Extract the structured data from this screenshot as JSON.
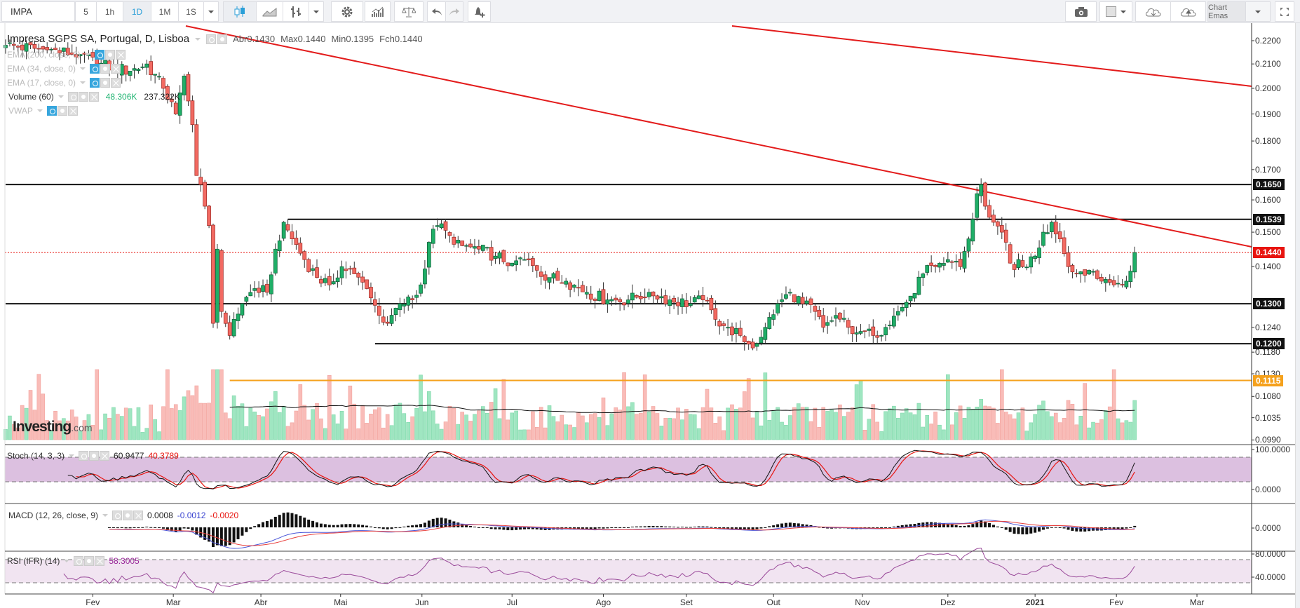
{
  "toolbar": {
    "symbol": "IMPA",
    "intervals": [
      "5",
      "1h",
      "1D",
      "1M",
      "1S"
    ],
    "active_interval": "1D",
    "chart_name": "Chart Emas"
  },
  "legend": {
    "title": "Impresa SGPS SA, Portugal, D, Lisboa",
    "open": "Abr0.1430",
    "high": "Max0.1440",
    "low": "Min0.1395",
    "close": "Fch0.1440",
    "ema200": "EMA (200, close, 0)",
    "ema34": "EMA (34, close, 0)",
    "ema17": "EMA (17, close, 0)",
    "volume": "Volume (60)",
    "volume_value": "48.306K",
    "volume_ma": "237.322K",
    "vwap": "VWAP",
    "stoch": "Stoch (14, 3, 3)",
    "stoch_k": "60.9477",
    "stoch_d": "40.3789",
    "macd": "MACD (12, 26, close, 9)",
    "macd_hist": "0.0008",
    "macd_line": "-0.0012",
    "macd_signal": "-0.0020",
    "rsi": "RSI (IFR) (14)",
    "rsi_value": "58.3005"
  },
  "logo": {
    "brand": "Investing",
    "suffix": ".com"
  },
  "colors": {
    "up": "#1fae67",
    "down": "#f26a62",
    "trend": "#e31b1b",
    "support": "#111111",
    "orange": "#f5a11c",
    "last": "#e8140f",
    "stoch_fill": "#dcc0e0",
    "rsi_fill": "#f1e4f1",
    "rsi_line": "#9a4a9a",
    "macd_line": "#4a55d8",
    "signal_line": "#e8403d"
  },
  "chart_data": {
    "type": "candlestick",
    "scale": "log",
    "ylim": [
      0.099,
      0.22
    ],
    "price_anchors": [
      [
        0,
        0.218
      ],
      [
        10,
        0.216
      ],
      [
        18,
        0.214
      ],
      [
        22,
        0.21
      ],
      [
        30,
        0.207
      ],
      [
        34,
        0.21
      ],
      [
        38,
        0.2
      ],
      [
        41,
        0.19
      ],
      [
        43,
        0.205
      ],
      [
        44,
        0.195
      ],
      [
        45,
        0.186
      ],
      [
        46,
        0.168
      ],
      [
        47,
        0.165
      ],
      [
        48,
        0.158
      ],
      [
        49,
        0.152
      ],
      [
        50,
        0.125
      ],
      [
        51,
        0.145
      ],
      [
        52,
        0.128
      ],
      [
        54,
        0.122
      ],
      [
        55,
        0.126
      ],
      [
        57,
        0.13
      ],
      [
        60,
        0.134
      ],
      [
        63,
        0.133
      ],
      [
        65,
        0.145
      ],
      [
        67,
        0.153
      ],
      [
        69,
        0.148
      ],
      [
        72,
        0.142
      ],
      [
        75,
        0.137
      ],
      [
        78,
        0.135
      ],
      [
        81,
        0.14
      ],
      [
        84,
        0.138
      ],
      [
        87,
        0.134
      ],
      [
        90,
        0.127
      ],
      [
        92,
        0.125
      ],
      [
        95,
        0.13
      ],
      [
        98,
        0.131
      ],
      [
        100,
        0.135
      ],
      [
        102,
        0.147
      ],
      [
        104,
        0.152
      ],
      [
        107,
        0.149
      ],
      [
        110,
        0.146
      ],
      [
        114,
        0.145
      ],
      [
        118,
        0.143
      ],
      [
        122,
        0.141
      ],
      [
        125,
        0.142
      ],
      [
        128,
        0.139
      ],
      [
        131,
        0.137
      ],
      [
        135,
        0.136
      ],
      [
        140,
        0.133
      ],
      [
        145,
        0.131
      ],
      [
        150,
        0.131
      ],
      [
        155,
        0.133
      ],
      [
        160,
        0.131
      ],
      [
        165,
        0.13
      ],
      [
        168,
        0.131
      ],
      [
        171,
        0.126
      ],
      [
        174,
        0.124
      ],
      [
        177,
        0.122
      ],
      [
        180,
        0.119
      ],
      [
        183,
        0.124
      ],
      [
        186,
        0.13
      ],
      [
        189,
        0.133
      ],
      [
        192,
        0.13
      ],
      [
        195,
        0.128
      ],
      [
        197,
        0.124
      ],
      [
        200,
        0.127
      ],
      [
        203,
        0.124
      ],
      [
        206,
        0.123
      ],
      [
        209,
        0.122
      ],
      [
        212,
        0.124
      ],
      [
        215,
        0.128
      ],
      [
        218,
        0.132
      ],
      [
        221,
        0.138
      ],
      [
        224,
        0.14
      ],
      [
        227,
        0.142
      ],
      [
        230,
        0.14
      ],
      [
        232,
        0.148
      ],
      [
        234,
        0.162
      ],
      [
        235,
        0.165
      ],
      [
        236,
        0.158
      ],
      [
        238,
        0.153
      ],
      [
        240,
        0.15
      ],
      [
        242,
        0.141
      ],
      [
        245,
        0.14
      ],
      [
        248,
        0.143
      ],
      [
        250,
        0.15
      ],
      [
        252,
        0.153
      ],
      [
        254,
        0.148
      ],
      [
        256,
        0.14
      ],
      [
        258,
        0.138
      ],
      [
        261,
        0.139
      ],
      [
        264,
        0.136
      ],
      [
        267,
        0.135
      ],
      [
        270,
        0.136
      ],
      [
        272,
        0.144
      ]
    ],
    "y_ticks": [
      "0.2200",
      "0.2100",
      "0.2000",
      "0.1900",
      "0.1800",
      "0.1700",
      "0.1600",
      "0.1500",
      "0.1400",
      "0.1240",
      "0.1180",
      "0.1130",
      "0.1080",
      "0.1035",
      "0.0990"
    ],
    "price_tags": [
      {
        "label": "0.1650",
        "value": 0.165,
        "color": "#111111"
      },
      {
        "label": "0.1539",
        "value": 0.1539,
        "color": "#111111"
      },
      {
        "label": "0.1440",
        "value": 0.144,
        "color": "#e8140f"
      },
      {
        "label": "0.1300",
        "value": 0.13,
        "color": "#111111"
      },
      {
        "label": "0.1200",
        "value": 0.12,
        "color": "#111111"
      },
      {
        "label": "0.1115",
        "value": 0.1115,
        "color": "#f5a11c"
      }
    ],
    "horizontal_lines": [
      {
        "value": 0.165,
        "from_index": 0,
        "color": "#111111"
      },
      {
        "value": 0.1539,
        "from_index": 68,
        "color": "#111111"
      },
      {
        "value": 0.13,
        "from_index": 0,
        "color": "#111111"
      },
      {
        "value": 0.12,
        "from_index": 89,
        "color": "#111111"
      },
      {
        "value": 0.1115,
        "from_index": 54,
        "color": "#f5a11c"
      }
    ],
    "stoch_ticks": [
      "100.0000",
      "0.0000"
    ],
    "macd_ticks": [
      "0.0000"
    ],
    "rsi_ticks": [
      "80.0000",
      "40.0000"
    ],
    "x_ticks": [
      {
        "label": "Fev",
        "index": 21
      },
      {
        "label": "Mar",
        "index": 40.4
      },
      {
        "label": "Abr",
        "index": 61.5
      },
      {
        "label": "Mai",
        "index": 80.7
      },
      {
        "label": "Jun",
        "index": 100.3
      },
      {
        "label": "Jul",
        "index": 122
      },
      {
        "label": "Ago",
        "index": 144
      },
      {
        "label": "Set",
        "index": 164
      },
      {
        "label": "Out",
        "index": 185
      },
      {
        "label": "Nov",
        "index": 206.4
      },
      {
        "label": "Dez",
        "index": 227
      },
      {
        "label": "2021",
        "index": 248,
        "bold": true
      },
      {
        "label": "Fev",
        "index": 267.6
      },
      {
        "label": "Mar",
        "index": 287
      }
    ]
  }
}
